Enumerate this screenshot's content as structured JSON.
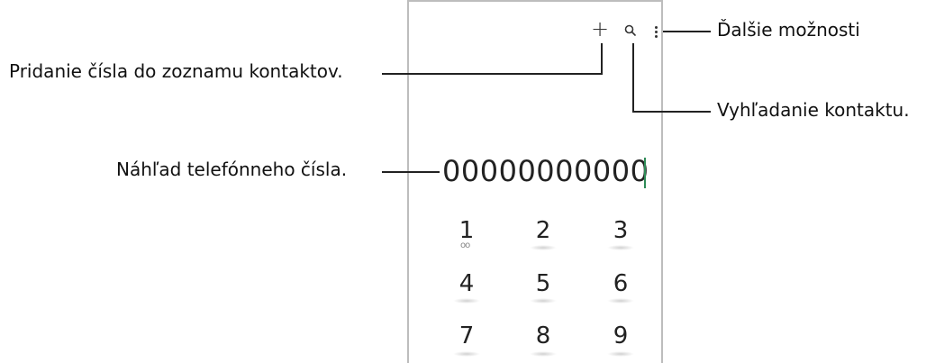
{
  "callouts": {
    "more_options": "Ďalšie možnosti",
    "add_contact": "Pridanie čísla do zoznamu kontaktov.",
    "search_contact": "Vyhľadanie kontaktu.",
    "number_preview": "Náhľad telefónneho čísla."
  },
  "phone": {
    "number": "00000000000",
    "toolbar": {
      "add_icon": "+",
      "search_icon": "search-icon",
      "more_icon": "more-vertical-icon"
    },
    "keypad": {
      "keys": [
        "1",
        "2",
        "3",
        "4",
        "5",
        "6",
        "7",
        "8",
        "9"
      ],
      "key1_sub": "oo"
    }
  }
}
